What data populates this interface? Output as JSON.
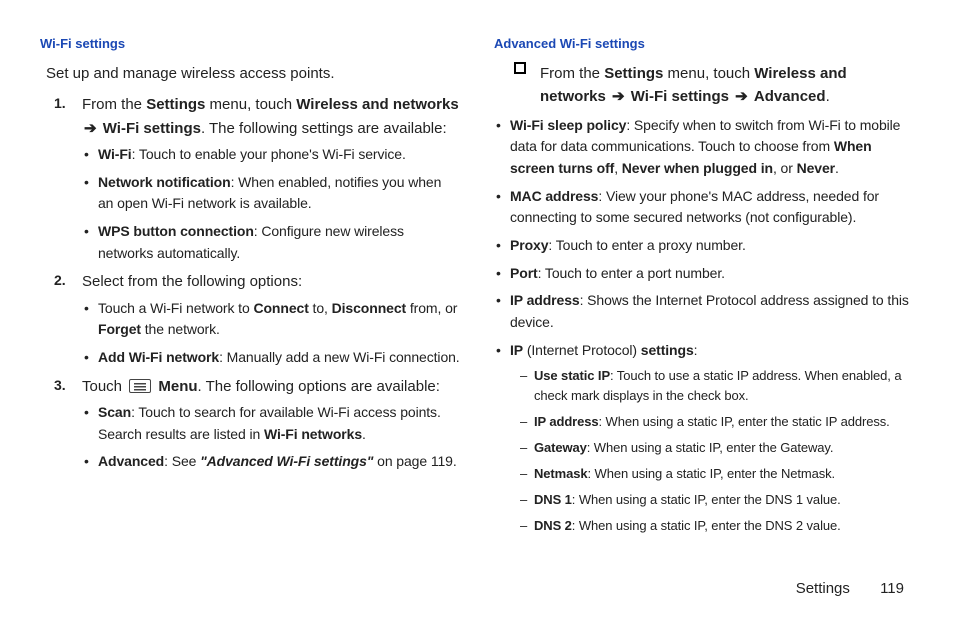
{
  "left": {
    "heading": "Wi-Fi settings",
    "intro": "Set up and manage wireless access points.",
    "step1": {
      "num": "1.",
      "pre": "From the ",
      "settings": "Settings",
      "mid": " menu, touch ",
      "wireless": "Wireless and networks",
      "arrow": " ➔ ",
      "wifi_settings": "Wi‑Fi settings",
      "post": ". The following settings are available:",
      "bullets": {
        "wifi_b": "Wi‑Fi",
        "wifi_t": ": Touch to enable your phone's Wi‑Fi service.",
        "nn_b": "Network notification",
        "nn_t": ": When enabled, notifies you when an open Wi‑Fi network is available.",
        "wps_b": "WPS button connection",
        "wps_t": ": Configure new wireless networks automatically."
      }
    },
    "step2": {
      "num": "2.",
      "text": "Select from the following options:",
      "b1_pre": "Touch a Wi‑Fi network to ",
      "b1_connect": "Connect",
      "b1_mid1": " to, ",
      "b1_disconnect": "Disconnect",
      "b1_mid2": " from, or ",
      "b1_forget": "Forget",
      "b1_post": " the network.",
      "b2_b": "Add Wi‑Fi network",
      "b2_t": ": Manually add a new Wi‑Fi connection."
    },
    "step3": {
      "num": "3.",
      "pre": "Touch ",
      "menu": "Menu",
      "post": ". The following options are available:",
      "scan_b": "Scan",
      "scan_t1": ": Touch to search for available Wi‑Fi access points. Search results are listed in ",
      "scan_t2": "Wi‑Fi networks",
      "scan_t3": ".",
      "adv_b": "Advanced",
      "adv_t1": ":  See ",
      "adv_i": "\"Advanced Wi‑Fi settings\"",
      "adv_t2": " on page 119."
    }
  },
  "right": {
    "heading": "Advanced Wi-Fi settings",
    "nav": {
      "pre": "From the ",
      "settings": "Settings",
      "mid": " menu, touch ",
      "wireless": "Wireless and networks",
      "arrow": " ➔ ",
      "wifi_settings": "Wi‑Fi settings",
      "advanced": "Advanced",
      "period": "."
    },
    "bul": {
      "sleep_b": "Wi‑Fi sleep policy",
      "sleep_t1": ": Specify when to switch from Wi‑Fi to mobile data for data communications. Touch to choose from ",
      "sleep_o1": "When screen turns off",
      "sleep_c1": ", ",
      "sleep_o2": "Never when plugged in",
      "sleep_c2": ", or ",
      "sleep_o3": "Never",
      "sleep_c3": ".",
      "mac_b": "MAC address",
      "mac_t": ": View your phone's MAC address, needed for connecting to some secured networks (not configurable).",
      "proxy_b": "Proxy",
      "proxy_t": ": Touch to enter a proxy number.",
      "port_b": "Port",
      "port_t": ": Touch to enter a port number.",
      "ipadd_b": "IP address",
      "ipadd_t": ": Shows the Internet Protocol address assigned to this device.",
      "ip_b": "IP",
      "ip_paren": " (Internet Protocol) ",
      "ip_set": "settings",
      "ip_colon": ":"
    },
    "dashes": {
      "usip_b": "Use static IP",
      "usip_t": ": Touch to use a static IP address. When enabled, a check mark displays in the check box.",
      "ipa_b": "IP address",
      "ipa_t": ": When using a static IP, enter the static IP address.",
      "gw_b": "Gateway",
      "gw_t": ": When using a static IP, enter the Gateway.",
      "nm_b": "Netmask",
      "nm_t": ": When using a static IP, enter the Netmask.",
      "d1_b": "DNS 1",
      "d1_t": ": When using a static IP, enter the DNS 1 value.",
      "d2_b": "DNS 2",
      "d2_t": ": When using a static IP, enter the DNS 2 value."
    }
  },
  "footer": {
    "section": "Settings",
    "page": "119"
  }
}
